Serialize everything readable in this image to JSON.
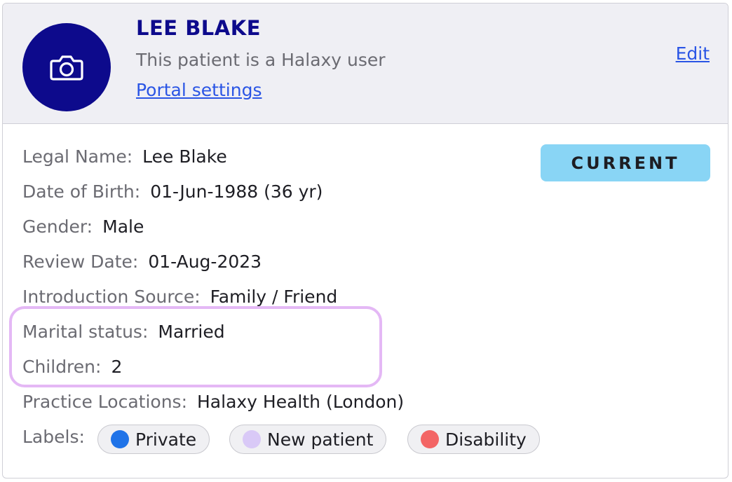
{
  "header": {
    "avatar_icon": "camera-icon",
    "name": "LEE BLAKE",
    "subtitle": "This patient is a Halaxy user",
    "portal_link": "Portal settings",
    "edit_link": "Edit"
  },
  "status": {
    "label": "CURRENT",
    "color": "#89d5f5"
  },
  "fields": [
    {
      "label": "Legal Name:",
      "value": "Lee Blake"
    },
    {
      "label": "Date of Birth:",
      "value": "01-Jun-1988 (36 yr)"
    },
    {
      "label": "Gender:",
      "value": "Male"
    },
    {
      "label": "Review Date:",
      "value": "01-Aug-2023"
    },
    {
      "label": "Introduction Source:",
      "value": "Family / Friend"
    },
    {
      "label": "Marital status:",
      "value": "Married"
    },
    {
      "label": "Children:",
      "value": "2"
    },
    {
      "label": "Practice Locations:",
      "value": "Halaxy Health (London)"
    }
  ],
  "labels": {
    "title": "Labels:",
    "chips": [
      {
        "text": "Private",
        "color": "#1f73e8"
      },
      {
        "text": "New patient",
        "color": "#d9c9f7"
      },
      {
        "text": "Disability",
        "color": "#f36565"
      }
    ]
  },
  "colors": {
    "brand": "#0d0a8c",
    "link": "#2a55e5",
    "highlight": "#e4b8f5"
  }
}
